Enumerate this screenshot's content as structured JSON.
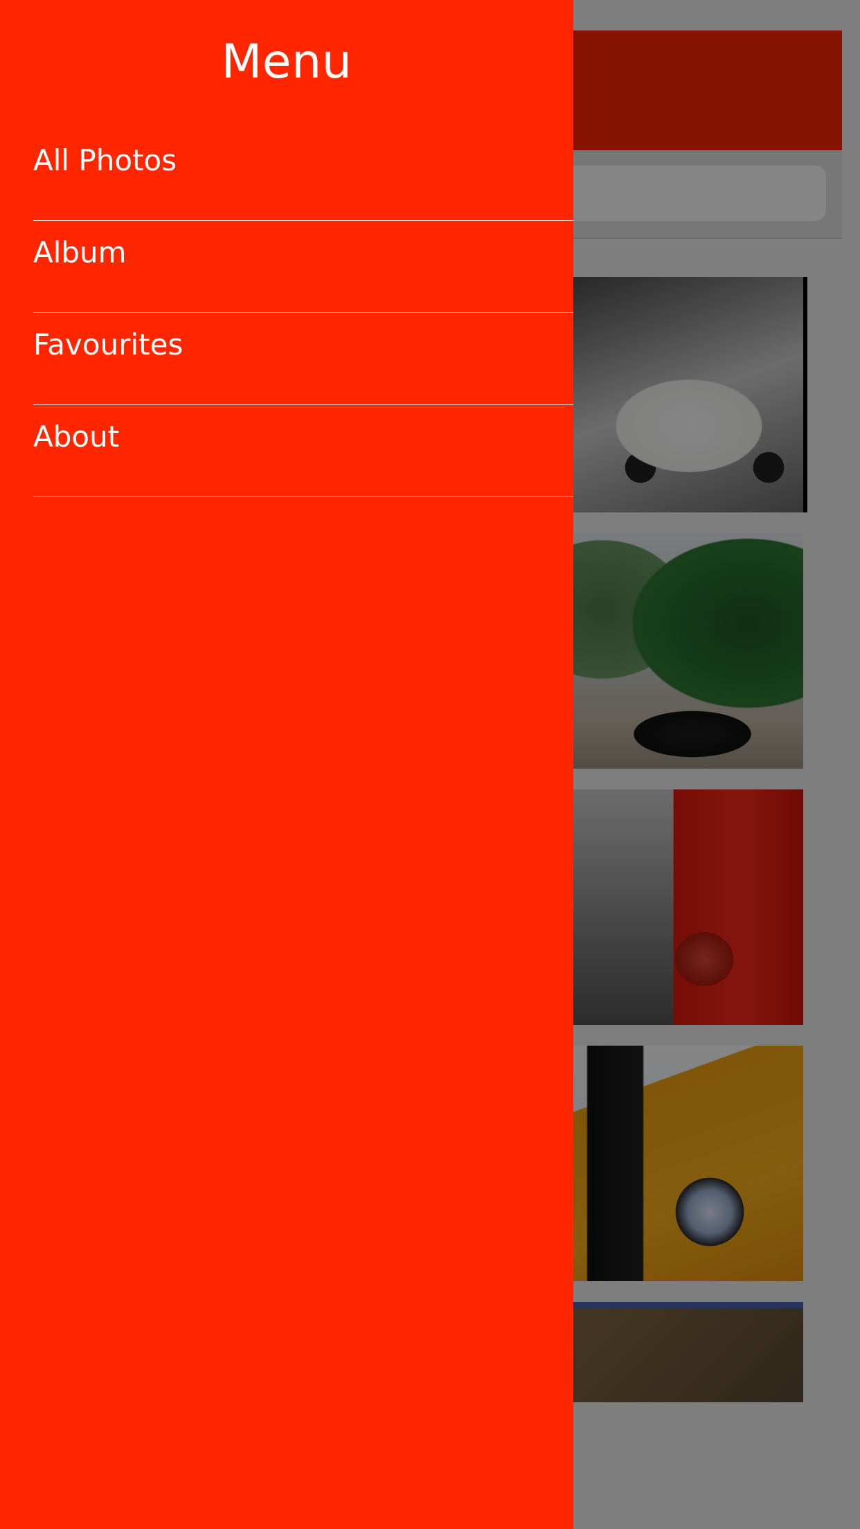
{
  "app": {
    "search_placeholder": ""
  },
  "drawer": {
    "title": "Menu",
    "items": [
      {
        "label": "All Photos"
      },
      {
        "label": "Album"
      },
      {
        "label": "Favourites"
      },
      {
        "label": "About"
      }
    ]
  },
  "colors": {
    "accent": "#ff2600",
    "overlay": "rgba(0,0,0,0.48)",
    "divider": "#ffffff"
  },
  "photos": [
    {
      "subject": "white mini cooper in parking garage"
    },
    {
      "subject": "black mini cooper under trees"
    },
    {
      "subject": "red austin mini cooper rear"
    },
    {
      "subject": "orange mini cooper s front by sea"
    },
    {
      "subject": "mini on cliff road"
    }
  ]
}
